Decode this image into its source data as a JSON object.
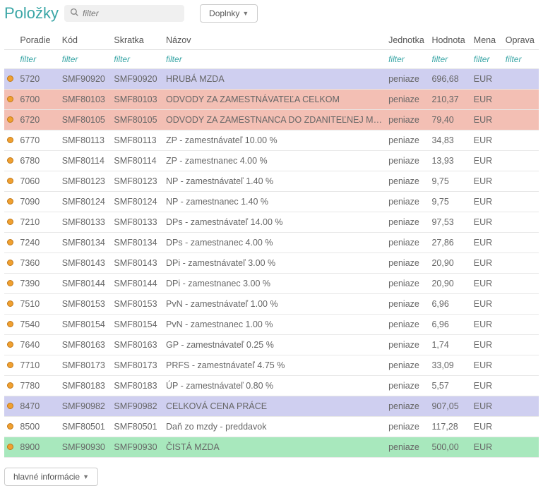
{
  "page": {
    "title": "Položky",
    "filter_placeholder": "filter",
    "addons_button": "Doplnky",
    "bottom_button": "hlavné informácie"
  },
  "columns": {
    "poradie": "Poradie",
    "kod": "Kód",
    "skratka": "Skratka",
    "nazov": "Názov",
    "jednotka": "Jednotka",
    "hodnota": "Hodnota",
    "mena": "Mena",
    "oprava": "Oprava"
  },
  "filter_label": "filter",
  "rows": [
    {
      "hl": "purple",
      "poradie": "5720",
      "kod": "SMF90920",
      "skratka": "SMF90920",
      "nazov": "HRUBÁ MZDA",
      "jednotka": "peniaze",
      "hodnota": "696,68",
      "mena": "EUR",
      "oprava": ""
    },
    {
      "hl": "red",
      "poradie": "6700",
      "kod": "SMF80103",
      "skratka": "SMF80103",
      "nazov": "ODVODY ZA ZAMESTNÁVATEĽA CELKOM",
      "jednotka": "peniaze",
      "hodnota": "210,37",
      "mena": "EUR",
      "oprava": ""
    },
    {
      "hl": "red",
      "poradie": "6720",
      "kod": "SMF80105",
      "skratka": "SMF80105",
      "nazov": "ODVODY ZA ZAMESTNANCA DO ZDANITEĽNEJ MZDY",
      "jednotka": "peniaze",
      "hodnota": "79,40",
      "mena": "EUR",
      "oprava": ""
    },
    {
      "hl": "",
      "poradie": "6770",
      "kod": "SMF80113",
      "skratka": "SMF80113",
      "nazov": "ZP - zamestnávateľ 10.00 %",
      "jednotka": "peniaze",
      "hodnota": "34,83",
      "mena": "EUR",
      "oprava": ""
    },
    {
      "hl": "",
      "poradie": "6780",
      "kod": "SMF80114",
      "skratka": "SMF80114",
      "nazov": "ZP - zamestnanec 4.00 %",
      "jednotka": "peniaze",
      "hodnota": "13,93",
      "mena": "EUR",
      "oprava": ""
    },
    {
      "hl": "",
      "poradie": "7060",
      "kod": "SMF80123",
      "skratka": "SMF80123",
      "nazov": "NP - zamestnávateľ 1.40 %",
      "jednotka": "peniaze",
      "hodnota": "9,75",
      "mena": "EUR",
      "oprava": ""
    },
    {
      "hl": "",
      "poradie": "7090",
      "kod": "SMF80124",
      "skratka": "SMF80124",
      "nazov": "NP - zamestnanec 1.40 %",
      "jednotka": "peniaze",
      "hodnota": "9,75",
      "mena": "EUR",
      "oprava": ""
    },
    {
      "hl": "",
      "poradie": "7210",
      "kod": "SMF80133",
      "skratka": "SMF80133",
      "nazov": "DPs - zamestnávateľ 14.00 %",
      "jednotka": "peniaze",
      "hodnota": "97,53",
      "mena": "EUR",
      "oprava": ""
    },
    {
      "hl": "",
      "poradie": "7240",
      "kod": "SMF80134",
      "skratka": "SMF80134",
      "nazov": "DPs - zamestnanec 4.00 %",
      "jednotka": "peniaze",
      "hodnota": "27,86",
      "mena": "EUR",
      "oprava": ""
    },
    {
      "hl": "",
      "poradie": "7360",
      "kod": "SMF80143",
      "skratka": "SMF80143",
      "nazov": "DPi - zamestnávateľ 3.00 %",
      "jednotka": "peniaze",
      "hodnota": "20,90",
      "mena": "EUR",
      "oprava": ""
    },
    {
      "hl": "",
      "poradie": "7390",
      "kod": "SMF80144",
      "skratka": "SMF80144",
      "nazov": "DPi - zamestnanec 3.00 %",
      "jednotka": "peniaze",
      "hodnota": "20,90",
      "mena": "EUR",
      "oprava": ""
    },
    {
      "hl": "",
      "poradie": "7510",
      "kod": "SMF80153",
      "skratka": "SMF80153",
      "nazov": "PvN - zamestnávateľ 1.00 %",
      "jednotka": "peniaze",
      "hodnota": "6,96",
      "mena": "EUR",
      "oprava": ""
    },
    {
      "hl": "",
      "poradie": "7540",
      "kod": "SMF80154",
      "skratka": "SMF80154",
      "nazov": "PvN - zamestnanec 1.00 %",
      "jednotka": "peniaze",
      "hodnota": "6,96",
      "mena": "EUR",
      "oprava": ""
    },
    {
      "hl": "",
      "poradie": "7640",
      "kod": "SMF80163",
      "skratka": "SMF80163",
      "nazov": "GP - zamestnávateľ 0.25 %",
      "jednotka": "peniaze",
      "hodnota": "1,74",
      "mena": "EUR",
      "oprava": ""
    },
    {
      "hl": "",
      "poradie": "7710",
      "kod": "SMF80173",
      "skratka": "SMF80173",
      "nazov": "PRFS - zamestnávateľ 4.75 %",
      "jednotka": "peniaze",
      "hodnota": "33,09",
      "mena": "EUR",
      "oprava": ""
    },
    {
      "hl": "",
      "poradie": "7780",
      "kod": "SMF80183",
      "skratka": "SMF80183",
      "nazov": "ÚP - zamestnávateľ 0.80 %",
      "jednotka": "peniaze",
      "hodnota": "5,57",
      "mena": "EUR",
      "oprava": ""
    },
    {
      "hl": "purple",
      "poradie": "8470",
      "kod": "SMF90982",
      "skratka": "SMF90982",
      "nazov": "CELKOVÁ CENA PRÁCE",
      "jednotka": "peniaze",
      "hodnota": "907,05",
      "mena": "EUR",
      "oprava": ""
    },
    {
      "hl": "",
      "poradie": "8500",
      "kod": "SMF80501",
      "skratka": "SMF80501",
      "nazov": "Daň zo mzdy - preddavok",
      "jednotka": "peniaze",
      "hodnota": "117,28",
      "mena": "EUR",
      "oprava": ""
    },
    {
      "hl": "green",
      "poradie": "8900",
      "kod": "SMF90930",
      "skratka": "SMF90930",
      "nazov": "ČISTÁ MZDA",
      "jednotka": "peniaze",
      "hodnota": "500,00",
      "mena": "EUR",
      "oprava": ""
    }
  ]
}
